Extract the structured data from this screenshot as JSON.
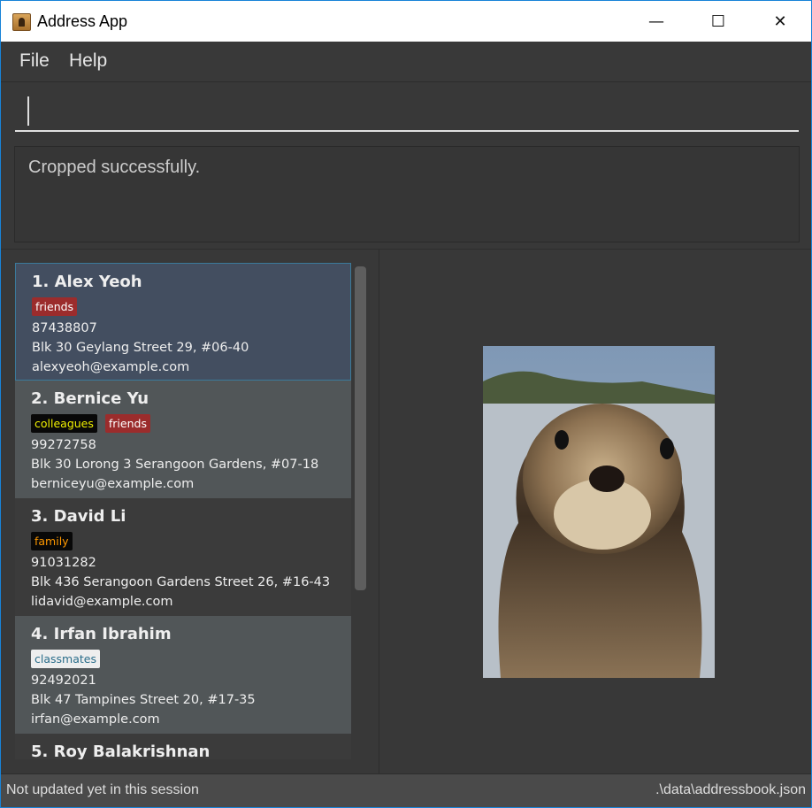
{
  "window": {
    "title": "Address App",
    "minimize": "—",
    "maximize": "☐",
    "close": "✕"
  },
  "menu": {
    "file": "File",
    "help": "Help"
  },
  "command": {
    "value": ""
  },
  "result": {
    "text": "Cropped successfully."
  },
  "persons": [
    {
      "index": "1.",
      "name": "Alex Yeoh",
      "tags": [
        {
          "label": "friends",
          "bg": "#9b2c2c",
          "fg": "#ffffff"
        }
      ],
      "phone": "87438807",
      "address": "Blk 30 Geylang Street 29, #06-40",
      "email": "alexyeoh@example.com",
      "selected": true
    },
    {
      "index": "2.",
      "name": "Bernice Yu",
      "tags": [
        {
          "label": "colleagues",
          "bg": "#080808",
          "fg": "#f0f000"
        },
        {
          "label": "friends",
          "bg": "#9b2c2c",
          "fg": "#ffffff"
        }
      ],
      "phone": "99272758",
      "address": "Blk 30 Lorong 3 Serangoon Gardens, #07-18",
      "email": "berniceyu@example.com"
    },
    {
      "index": "3.",
      "name": "David Li",
      "tags": [
        {
          "label": "family",
          "bg": "#080808",
          "fg": "#ff9900"
        }
      ],
      "phone": "91031282",
      "address": "Blk 436 Serangoon Gardens Street 26, #16-43",
      "email": "lidavid@example.com"
    },
    {
      "index": "4.",
      "name": "Irfan Ibrahim",
      "tags": [
        {
          "label": "classmates",
          "bg": "#eeeeee",
          "fg": "#2a6d8a"
        }
      ],
      "phone": "92492021",
      "address": "Blk 47 Tampines Street 20, #17-35",
      "email": "irfan@example.com"
    },
    {
      "index": "5.",
      "name": "Roy Balakrishnan",
      "tags": [],
      "phone": "",
      "address": "",
      "email": ""
    }
  ],
  "status": {
    "left": "Not updated yet in this session",
    "right": ".\\data\\addressbook.json"
  }
}
